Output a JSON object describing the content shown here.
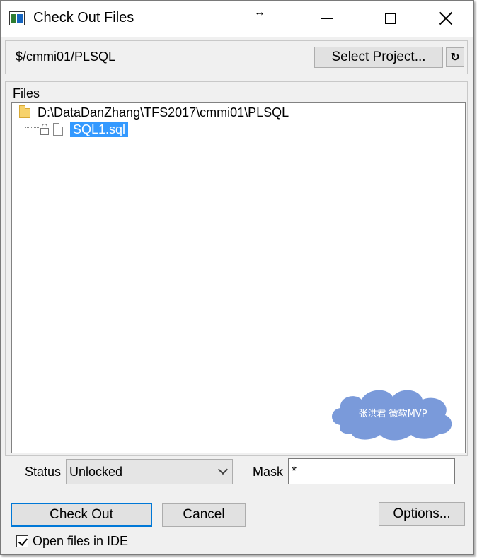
{
  "window": {
    "title": "Check Out Files"
  },
  "project": {
    "path": "$/cmmi01/PLSQL",
    "select_label": "Select Project...",
    "refresh_glyph": "↻"
  },
  "files": {
    "label": "Files",
    "root_path": "D:\\DataDanZhang\\TFS2017\\cmmi01\\PLSQL",
    "items": [
      {
        "name": "SQL1.sql",
        "selected": true,
        "icon": "lock-icon"
      }
    ]
  },
  "watermark": {
    "text": "张洪君  微软MVP"
  },
  "filters": {
    "status_label": "Status",
    "status_value": "Unlocked",
    "mask_label": "Mask",
    "mask_value": "*"
  },
  "buttons": {
    "checkout": "Check Out",
    "cancel": "Cancel",
    "options": "Options..."
  },
  "options": {
    "open_in_ide_label": "Open files in IDE",
    "open_in_ide_checked": true
  },
  "colors": {
    "selection": "#3399ff",
    "focus_border": "#0078d7",
    "cloud": "#6c8fd6"
  }
}
